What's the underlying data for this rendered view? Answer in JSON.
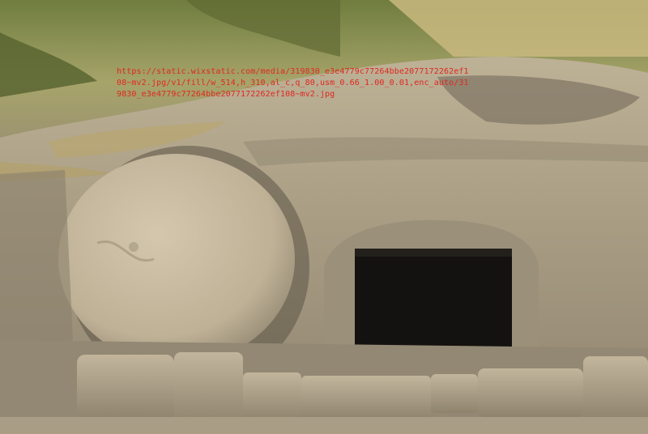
{
  "photo": {
    "subject": "rock-cut tomb with rolling stone",
    "overlay_text": "https://static.wixstatic.com/media/319830_e3e4779c77264bbe2077172262ef108~mv2.jpg/v1/fill/w_514,h_310,al_c,q_80,usm_0.66_1.00_0.01,enc_auto/319830_e3e4779c77264bbe2077172262ef108~mv2.jpg"
  },
  "colors": {
    "sky_grass": "#9aa35a",
    "rock": "#b0a48c",
    "stone_disc": "#c6b8a0",
    "doorway": "#141210",
    "overlay_text": "#e0281f"
  }
}
